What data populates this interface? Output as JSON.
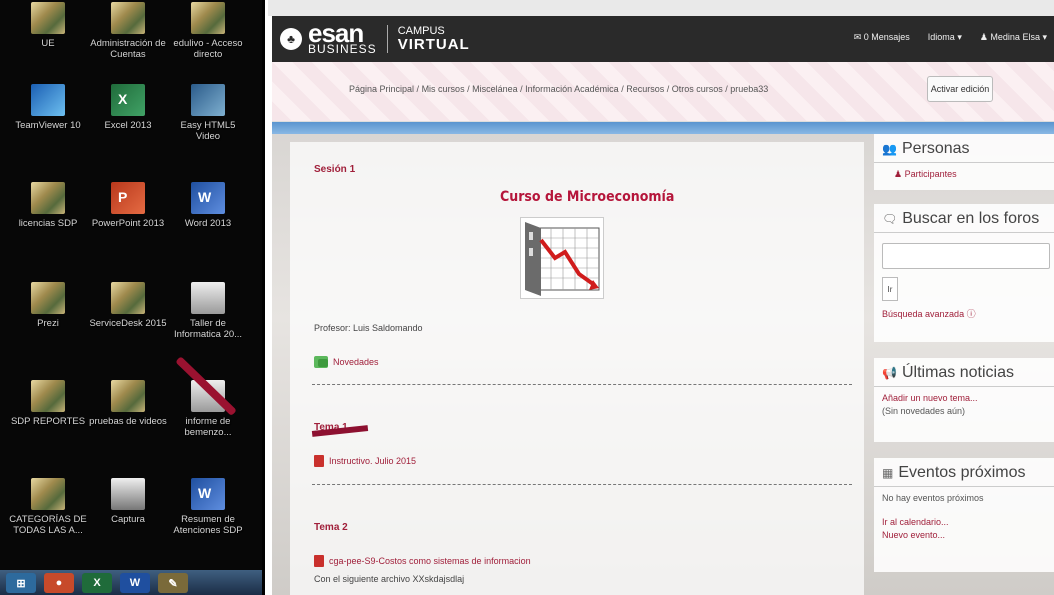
{
  "desktop": {
    "icons": [
      {
        "label": "UE",
        "kind": "folder"
      },
      {
        "label": "Administración de Cuentas",
        "kind": "folder"
      },
      {
        "label": "edulivo - Acceso directo",
        "kind": "folder"
      },
      {
        "label": "TeamViewer 10",
        "kind": "tv"
      },
      {
        "label": "Excel 2013",
        "kind": "excel"
      },
      {
        "label": "Easy HTML5 Video",
        "kind": "easy"
      },
      {
        "label": "licencias SDP",
        "kind": "folder"
      },
      {
        "label": "PowerPoint 2013",
        "kind": "ppt"
      },
      {
        "label": "Word 2013",
        "kind": "word"
      },
      {
        "label": "Prezi",
        "kind": "folder"
      },
      {
        "label": "ServiceDesk 2015",
        "kind": "folder"
      },
      {
        "label": "Taller de Informatica 20...",
        "kind": "doc"
      },
      {
        "label": "SDP REPORTES",
        "kind": "folder"
      },
      {
        "label": "pruebas de videos",
        "kind": "folder"
      },
      {
        "label": "informe de bemenzo...",
        "kind": "doc"
      },
      {
        "label": "CATEGORÍAS DE TODAS LAS A...",
        "kind": "folder"
      },
      {
        "label": "Captura",
        "kind": "capt"
      },
      {
        "label": "Resumen de Atenciones SDP",
        "kind": "word"
      }
    ],
    "taskbar": [
      "chrome-icon",
      "excel-icon",
      "word-icon",
      "paint-icon"
    ]
  },
  "header": {
    "brand_main": "esan",
    "brand_sub": "BUSINESS",
    "campus": "CAMPUS",
    "virtual": "VIRTUAL",
    "messages": "0 Mensajes",
    "language": "Idioma",
    "user": "Medina Elsa"
  },
  "breadcrumb": [
    "Página Principal",
    "Mis cursos",
    "Miscelánea",
    "Información Académica",
    "Recursos",
    "Otros cursos",
    "prueba33"
  ],
  "breadcrumb_sep": " / ",
  "edit_button": "Activar edición",
  "course": {
    "section1": "Sesión 1",
    "title": "Curso de Microeconomía",
    "professor": "Profesor: Luis Saldomando",
    "news_link": "Novedades",
    "tema1": "Tema 1",
    "tema1_link": "Instructivo. Julio 2015",
    "tema2": "Tema 2",
    "tema2_link": "cga-pee-S9-Costos como sistemas de informacion",
    "tema2_note": "Con el siguiente archivo XXskdajsdlaj"
  },
  "sidebar": {
    "personas_title": "Personas",
    "participants": "Participantes",
    "search_title": "Buscar en los foros",
    "search_btn": "Ir",
    "advanced_search": "Búsqueda avanzada",
    "news_title": "Últimas noticias",
    "add_topic": "Añadir un nuevo tema...",
    "no_news": "(Sin novedades aún)",
    "events_title": "Eventos próximos",
    "no_events": "No hay eventos próximos",
    "calendar": "Ir al calendario...",
    "new_event": "Nuevo evento..."
  },
  "colors": {
    "accent": "#a01f3a",
    "navbar": "#2a2a2a"
  }
}
